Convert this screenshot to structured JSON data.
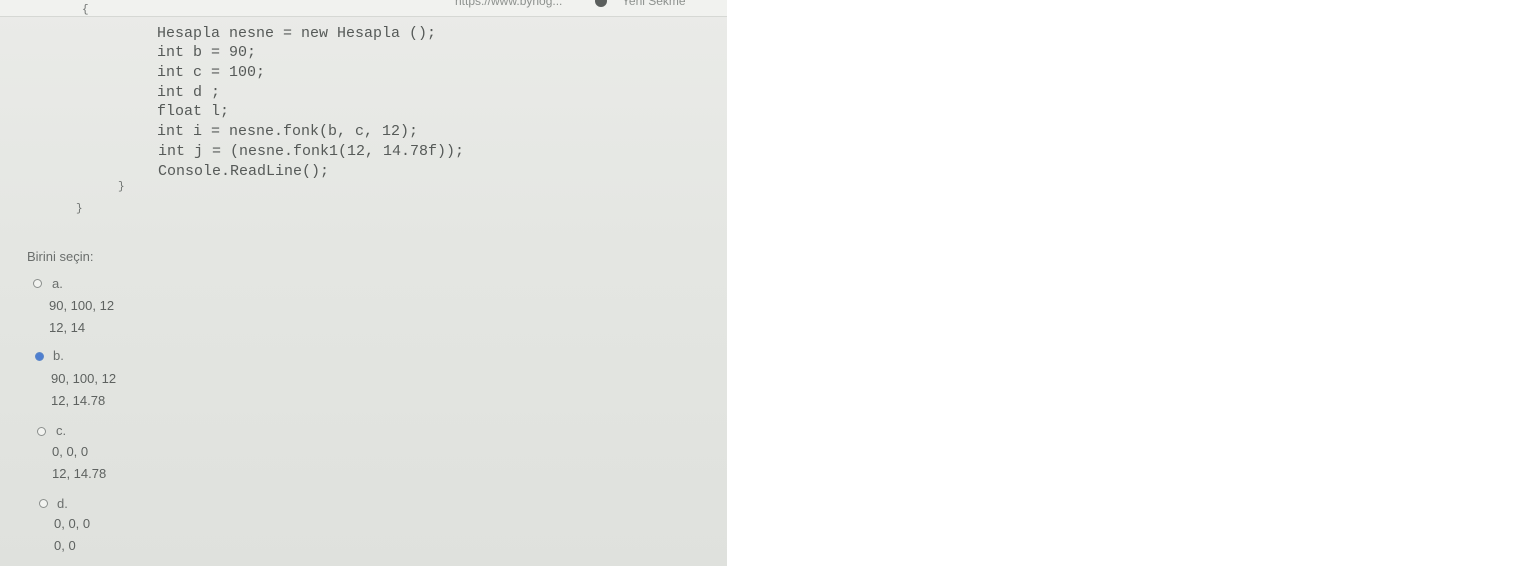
{
  "browser": {
    "tab_fragment_left": "https://www.bynog...",
    "tab_fragment_right": "Yeni Sekme"
  },
  "code": {
    "lines": [
      "Hesapla nesne = new Hesapla ();",
      "int b = 90;",
      "int c = 100;",
      "int d ;",
      "float l;",
      "int i = nesne.fonk(b, c, 12);",
      "int j = (nesne.fonk1(12, 14.78f));",
      "Console.ReadLine();"
    ],
    "brace_open": "{",
    "brace_close_inner": "}",
    "brace_close_outer": "}"
  },
  "question": {
    "prompt": "Birini seçin:",
    "options": [
      {
        "letter": "a.",
        "lines": [
          "90, 100, 12",
          "12, 14"
        ],
        "selected": false
      },
      {
        "letter": "b.",
        "lines": [
          "90, 100, 12",
          "12, 14.78"
        ],
        "selected": true
      },
      {
        "letter": "c.",
        "lines": [
          "0, 0, 0",
          "12, 14.78"
        ],
        "selected": false
      },
      {
        "letter": "d.",
        "lines": [
          "0, 0, 0",
          "0, 0"
        ],
        "selected": false
      }
    ]
  },
  "colors": {
    "selected_radio": "#4f7fd0"
  }
}
